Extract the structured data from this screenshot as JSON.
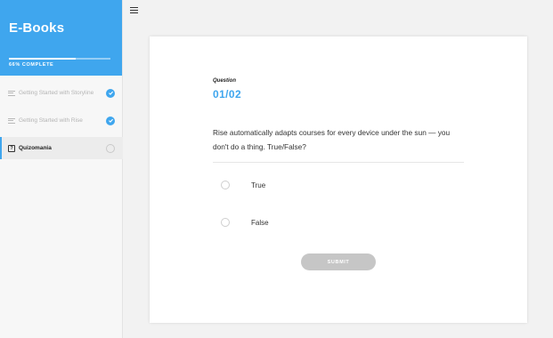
{
  "sidebar": {
    "course_title": "E-Books",
    "progress_percent": 66,
    "progress_label": "66% COMPLETE",
    "lessons": [
      {
        "label": "Getting Started with Storyline",
        "status": "complete"
      },
      {
        "label": "Getting Started with Rise",
        "status": "complete"
      },
      {
        "label": "Quizomania",
        "status": "current"
      }
    ]
  },
  "quiz": {
    "kicker": "Question",
    "number": "01/02",
    "question_text": "Rise automatically adapts courses for every device under the sun — you don't do a thing. True/False?",
    "options": [
      {
        "label": "True",
        "selected": false
      },
      {
        "label": "False",
        "selected": false
      }
    ],
    "submit_label": "SUBMIT"
  },
  "colors": {
    "accent": "#3fa6ee",
    "submit_disabled": "#c6c6c6"
  }
}
